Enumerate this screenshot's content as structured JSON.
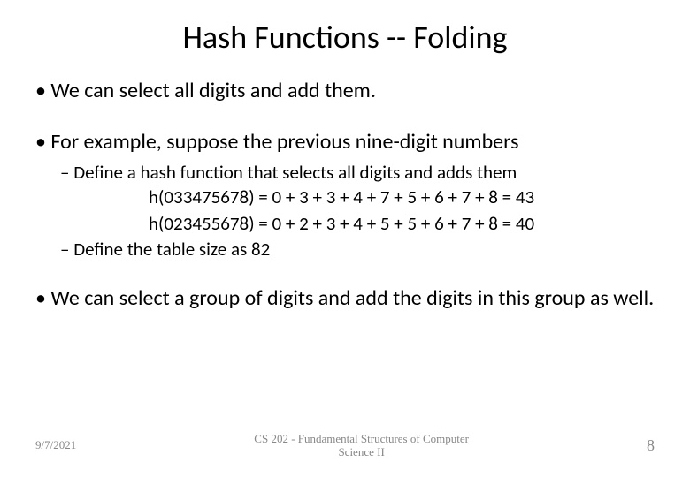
{
  "title": "Hash Functions -- Folding",
  "bullets": {
    "b1": "We can select all digits and add them.",
    "b2": "For example, suppose the previous nine-digit numbers",
    "b2_sub1": "Define a hash function that selects all digits and adds them",
    "b2_calc1": "h(033475678) = 0 + 3 + 3 + 4 + 7 + 5 + 6 + 7 + 8 = 43",
    "b2_calc2": "h(023455678) = 0 + 2 + 3 + 4 + 5 + 5 + 6 + 7 + 8 = 40",
    "b2_sub2": "Define the table size as 82",
    "b3": "We can select a group of digits and add the digits in this group as well."
  },
  "footer": {
    "date": "9/7/2021",
    "course_line1": "CS 202 - Fundamental Structures of Computer",
    "course_line2": "Science II",
    "page": "8"
  }
}
